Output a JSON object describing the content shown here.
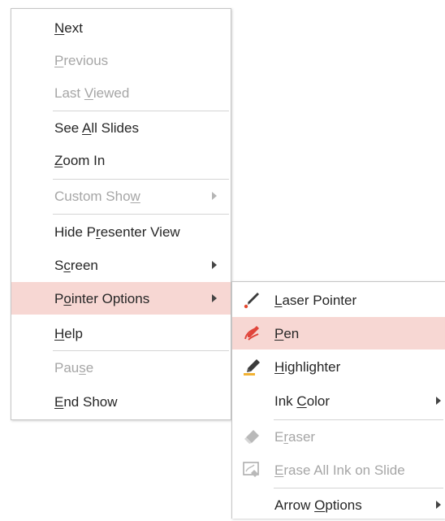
{
  "main_menu": {
    "items": [
      {
        "pre": "",
        "key": "N",
        "post": "ext",
        "disabled": false
      },
      {
        "pre": "",
        "key": "P",
        "post": "revious",
        "disabled": true
      },
      {
        "pre": "Last ",
        "key": "V",
        "post": "iewed",
        "disabled": true
      },
      {
        "pre": "See ",
        "key": "A",
        "post": "ll Slides",
        "disabled": false
      },
      {
        "pre": "",
        "key": "Z",
        "post": "oom In",
        "disabled": false
      },
      {
        "pre": "Custom Sho",
        "key": "w",
        "post": "",
        "disabled": true
      },
      {
        "pre": "Hide P",
        "key": "r",
        "post": "esenter View",
        "disabled": false
      },
      {
        "pre": "S",
        "key": "c",
        "post": "reen",
        "disabled": false
      },
      {
        "pre": "P",
        "key": "o",
        "post": "inter Options",
        "disabled": false
      },
      {
        "pre": "",
        "key": "H",
        "post": "elp",
        "disabled": false
      },
      {
        "pre": "Pau",
        "key": "s",
        "post": "e",
        "disabled": true
      },
      {
        "pre": "",
        "key": "E",
        "post": "nd Show",
        "disabled": false
      }
    ]
  },
  "pointer_submenu": {
    "items": [
      {
        "pre": "",
        "key": "L",
        "post": "aser Pointer",
        "icon": "laser-pointer-icon",
        "disabled": false
      },
      {
        "pre": "",
        "key": "P",
        "post": "en",
        "icon": "pen-icon",
        "disabled": false
      },
      {
        "pre": "",
        "key": "H",
        "post": "ighlighter",
        "icon": "highlighter-icon",
        "disabled": false
      },
      {
        "pre": "Ink ",
        "key": "C",
        "post": "olor",
        "icon": "",
        "disabled": false
      },
      {
        "pre": "E",
        "key": "r",
        "post": "aser",
        "icon": "eraser-icon",
        "disabled": true
      },
      {
        "pre": "",
        "key": "E",
        "post": "rase All Ink on Slide",
        "icon": "erase-all-ink-icon",
        "disabled": true
      },
      {
        "pre": "Arrow ",
        "key": "O",
        "post": "ptions",
        "icon": "",
        "disabled": false
      }
    ]
  },
  "colors": {
    "highlight": "#f7d7d3",
    "disabled_text": "#a6a6a6",
    "text": "#262626"
  }
}
